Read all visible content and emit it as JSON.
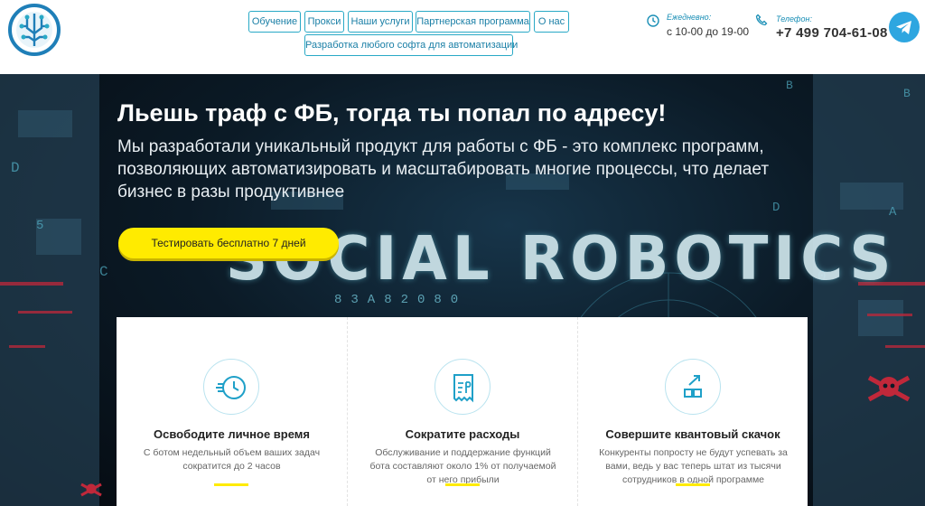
{
  "header": {
    "nav": [
      {
        "label": "Обучение"
      },
      {
        "label": "Прокси"
      },
      {
        "label": "Наши услуги"
      },
      {
        "label": "Партнерская программа"
      },
      {
        "label": "О нас"
      },
      {
        "label": "Разработка любого софта для автоматизации"
      }
    ],
    "hours_label": "Ежедневно:",
    "hours_value": "с 10-00 до 19-00",
    "phone_label": "Телефон:",
    "phone_value": "+7 499 704-61-08"
  },
  "hero": {
    "title": "Льешь траф с ФБ, тогда ты попал по адресу!",
    "subtitle": "Мы разработали уникальный продукт для работы с ФБ - это комплекс программ, позволяющих автоматизировать и масштабировать многие процессы, что делает бизнес в разы продуктивнее",
    "cta": "Тестировать бесплатно 7 дней",
    "brand": "SOCIAL ROBOTICS",
    "brand_digits": "83A82080"
  },
  "cards": [
    {
      "title": "Освободите личное время",
      "text": "С ботом недельный объем ваших задач сократится до 2 часов",
      "icon": "clock-icon"
    },
    {
      "title": "Сократите расходы",
      "text": "Обслуживание и поддержание функций бота составляют около 1% от получаемой от него прибыли",
      "icon": "receipt-icon"
    },
    {
      "title": "Совершите квантовый скачок",
      "text": "Конкуренты попросту не будут успевать за вами, ведь у вас теперь штат из тысячи сотрудников в одной программе",
      "icon": "growth-icon"
    }
  ],
  "colors": {
    "accent": "#29a9c6",
    "cta": "#ffeb00",
    "telegram": "#2ea6e0"
  }
}
